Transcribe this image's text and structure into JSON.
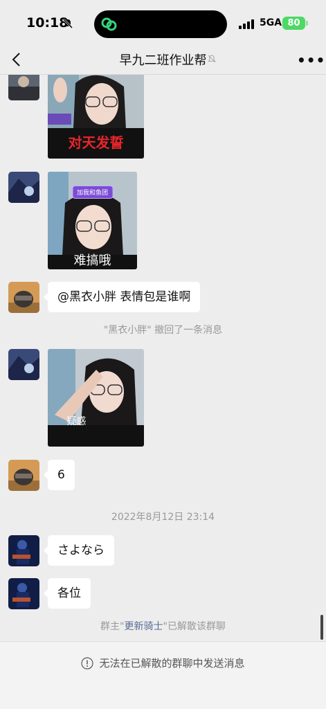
{
  "status_bar": {
    "time": "10:18",
    "network": "5GA",
    "battery": "80"
  },
  "header": {
    "title": "早九二班作业帮"
  },
  "messages": {
    "sticker_1": {
      "caption": "对天发誓",
      "badge": ""
    },
    "sticker_2": {
      "caption": "难搞哦",
      "badge": "加我和鱼团"
    },
    "text_1": "@黑衣小胖 表情包是谁啊",
    "recall_notice": "\"黑衣小胖\" 撤回了一条消息",
    "sticker_3": {
      "caption": "疑惑"
    },
    "text_2": "6",
    "timestamp": "2022年8月12日 23:14",
    "text_3": "さよなら",
    "text_4": "各位",
    "disband_notice": {
      "prefix": "群主\"",
      "owner": "更新骑士",
      "suffix": "\"已解散该群聊"
    }
  },
  "footer": {
    "notice": "无法在已解散的群聊中发送消息"
  },
  "colors": {
    "background": "#ededed",
    "link": "#576b95",
    "battery": "#4cd964",
    "bubble": "#ffffff"
  }
}
